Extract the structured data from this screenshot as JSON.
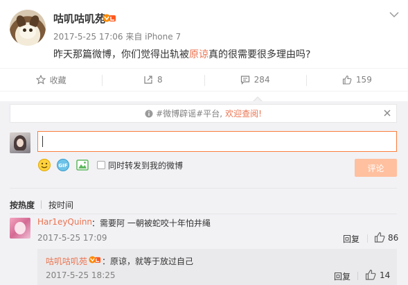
{
  "post": {
    "username": "咕叽咕叽苑",
    "meta": "2017-5-25 17:06 来自 iPhone 7",
    "text_before": "昨天那篇微博，你们觉得出轨被",
    "text_highlight": "原谅",
    "text_after": "真的很需要很多理由吗?"
  },
  "actions": {
    "favorite": "收藏",
    "repost": "8",
    "comment": "284",
    "like": "159"
  },
  "comment_box": {
    "notice_prefix": "#微博辟谣#平台,",
    "notice_link": "欢迎查阅!",
    "forward_label": "同时转发到我的微博",
    "submit_label": "评论"
  },
  "sort": {
    "hot": "按热度",
    "time": "按时间"
  },
  "comments": [
    {
      "user": "Har1eyQuinn",
      "text": "：需要阿 一朝被蛇咬十年怕井绳",
      "time": "2017-5-25 17:09",
      "reply_label": "回复",
      "likes": "86",
      "reply": {
        "user": "咕叽咕叽苑",
        "text": "：原谅，就等于放过自己",
        "time": "2017-5-25 18:25",
        "reply_label": "回复",
        "likes": "14"
      }
    }
  ],
  "colors": {
    "accent": "#eb7350",
    "input_border": "#fa7d3c",
    "submit_bg": "#ffc09f"
  }
}
